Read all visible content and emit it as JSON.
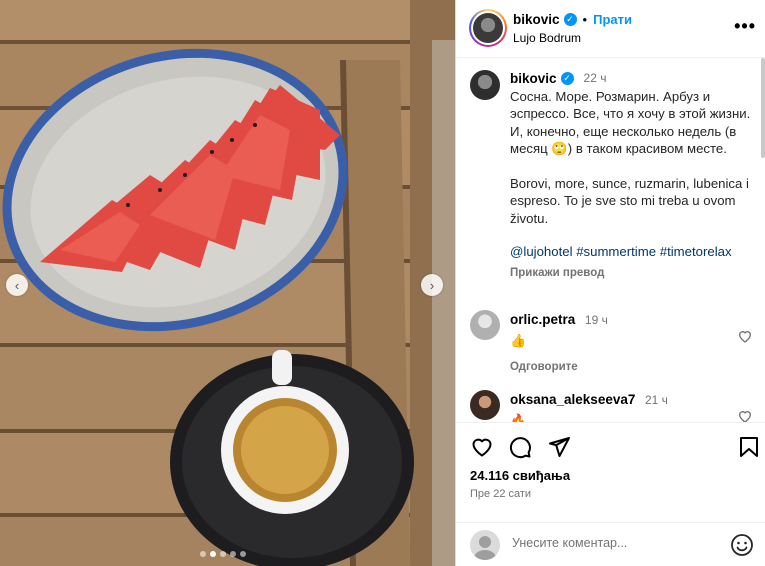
{
  "post": {
    "username": "bikovic",
    "follow_label": "Прати",
    "separator": "•",
    "location": "Lujo Bodrum",
    "more_label": "•••"
  },
  "caption": {
    "username": "bikovic",
    "time": "22 ч",
    "text_ru": "Сосна. Море. Розмарин. Арбуз и эспрессо. Все, что я хочу в этой жизни. И, конечно, еще несколько недель (в месяц 🙄) в таком красивом месте.",
    "text_sr": "Borovi, more, sunce, ruzmarin, lubenica i espreso. To je sve sto mi treba u ovom životu.",
    "tags": [
      "@lujohotel",
      "#summertime",
      "#timetorelax"
    ],
    "translate_label": "Прикажи превод"
  },
  "comments": [
    {
      "username": "orlic.petra",
      "time": "19 ч",
      "text": "👍",
      "reply_label": "Одговорите"
    },
    {
      "username": "oksana_alekseeva7",
      "time": "21 ч",
      "text": "🔥",
      "reply_label": ""
    }
  ],
  "actions": {
    "likes": "24.116 свиђања",
    "posted": "Пре 22 сати"
  },
  "composer": {
    "placeholder": "Унесите коментар..."
  },
  "carousel": {
    "slide_count": 5,
    "active_index": 1,
    "prev_label": "‹",
    "next_label": "›"
  },
  "colors": {
    "accent": "#0095f6",
    "link": "#00376b",
    "muted": "#737373"
  },
  "icons": [
    "heart-icon",
    "comment-icon",
    "share-icon",
    "save-icon",
    "emoji-icon",
    "verified-icon"
  ]
}
